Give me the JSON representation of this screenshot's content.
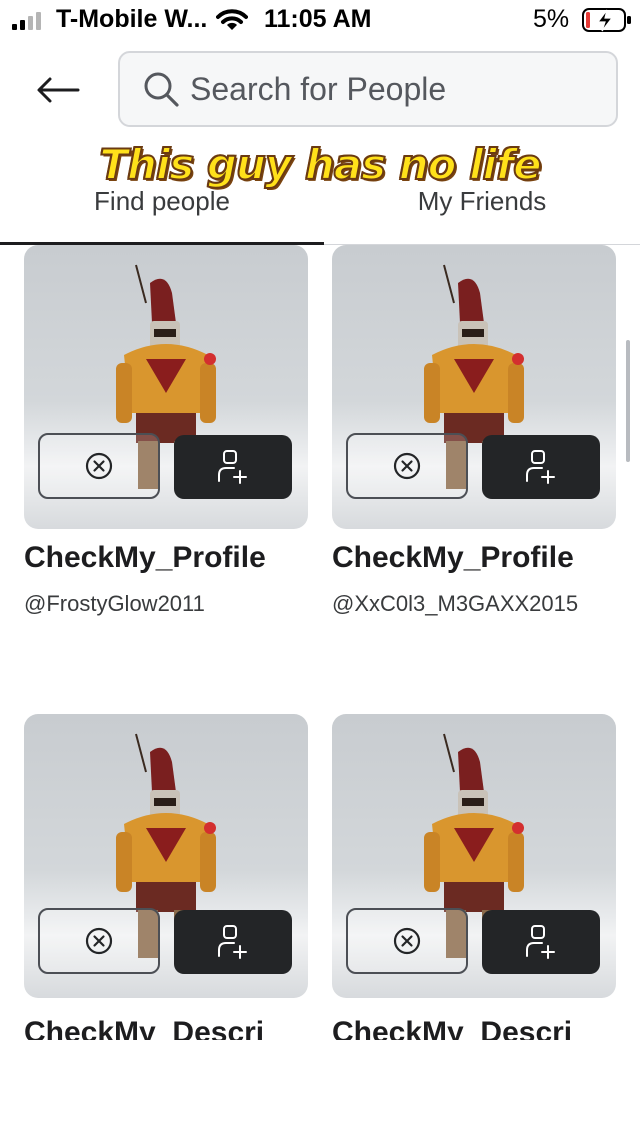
{
  "status_bar": {
    "carrier": "T-Mobile W...",
    "time": "11:05 AM",
    "battery_percent": "5%",
    "icons": [
      "signal-icon",
      "wifi-icon",
      "battery-charging-icon"
    ]
  },
  "header": {
    "back_icon": "arrow-left-icon",
    "search_placeholder": "Search for People",
    "search_icon": "search-icon"
  },
  "overlay_caption": "This guy has no life",
  "tabs": [
    {
      "label": "Find people",
      "active": true
    },
    {
      "label": "My Friends",
      "active": false
    }
  ],
  "cards": [
    {
      "display_name": "CheckMy_Profile",
      "username": "@FrostyGlow2011"
    },
    {
      "display_name": "CheckMy_Profile",
      "username": "@XxC0l3_M3GAXX2015"
    },
    {
      "display_name": "CheckMy_Descri",
      "username": ""
    },
    {
      "display_name": "CheckMy_Descri",
      "username": ""
    }
  ],
  "card_actions": {
    "decline_icon": "close-circle-icon",
    "add_icon": "add-friend-icon"
  },
  "colors": {
    "accent_dark": "#232527",
    "caption_yellow": "#ffe11a",
    "background": "#ffffff"
  }
}
